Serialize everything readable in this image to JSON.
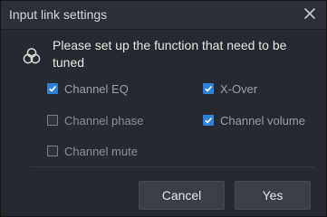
{
  "dialog": {
    "title": "Input link settings",
    "close_icon": "close-icon",
    "info_icon": "link-rings-icon",
    "prompt": "Please set up the function that need to be tuned"
  },
  "options": [
    {
      "label": "Channel EQ",
      "checked": true
    },
    {
      "label": "X-Over",
      "checked": true
    },
    {
      "label": "Channel phase",
      "checked": false
    },
    {
      "label": "Channel volume",
      "checked": true
    },
    {
      "label": "Channel mute",
      "checked": false
    }
  ],
  "buttons": {
    "cancel_label": "Cancel",
    "ok_label": "Yes"
  },
  "colors": {
    "accent": "#2d83d8",
    "background": "#262930",
    "button": "#3a3e47"
  }
}
